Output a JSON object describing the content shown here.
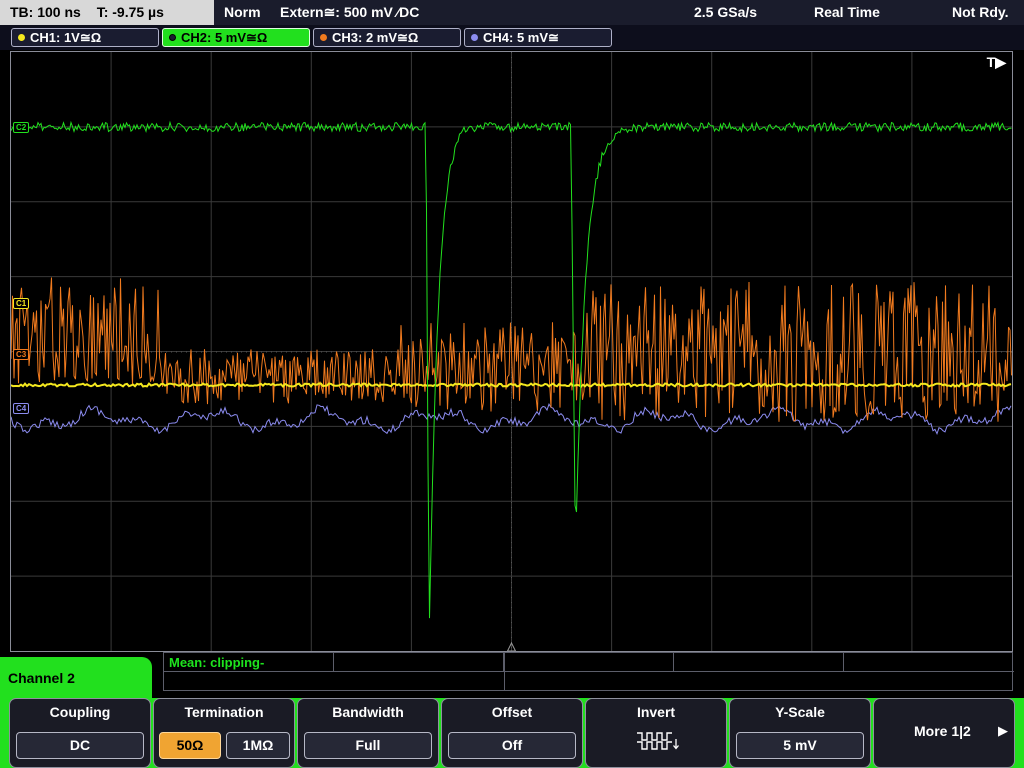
{
  "topbar": {
    "timebase": "TB: 100 ns",
    "trigger_time": "T: -9.75 µs",
    "acq_mode": "Norm",
    "trigger": "Extern≅: 500 mV ⁄DC",
    "sample_rate": "2.5 GSa/s",
    "acq_type": "Real Time",
    "status": "Not Rdy."
  },
  "channels": [
    {
      "label": "CH1: 1V≅Ω",
      "color": "#f4e81e",
      "ref": "C1"
    },
    {
      "label": "CH2: 5 mV≅Ω",
      "color": "#22e01e",
      "ref": "C2"
    },
    {
      "label": "CH3: 2 mV≅Ω",
      "color": "#f07a1e",
      "ref": "C3"
    },
    {
      "label": "CH4: 5 mV≅",
      "color": "#8c8cf0",
      "ref": "C4"
    }
  ],
  "display": {
    "trigger_position_icon": "T▶"
  },
  "measurement": {
    "text": "Mean: clipping-"
  },
  "menu": {
    "title": "Channel 2",
    "softkeys": {
      "coupling": {
        "title": "Coupling",
        "value": "DC"
      },
      "termination": {
        "title": "Termination",
        "options": [
          "50Ω",
          "1MΩ"
        ],
        "selected": "50Ω"
      },
      "bandwidth": {
        "title": "Bandwidth",
        "value": "Full"
      },
      "offset": {
        "title": "Offset",
        "value": "Off"
      },
      "invert": {
        "title": "Invert",
        "icon": "invert-waveform-icon"
      },
      "yscale": {
        "title": "Y-Scale",
        "value": "5 mV"
      },
      "more": {
        "label": "More 1|2",
        "icon": "right-arrow-icon"
      }
    }
  },
  "colors": {
    "ch1": "#f4e81e",
    "ch2": "#22e01e",
    "ch3": "#f07a1e",
    "ch4": "#8c8cf0",
    "grid": "#3a3a3a"
  }
}
